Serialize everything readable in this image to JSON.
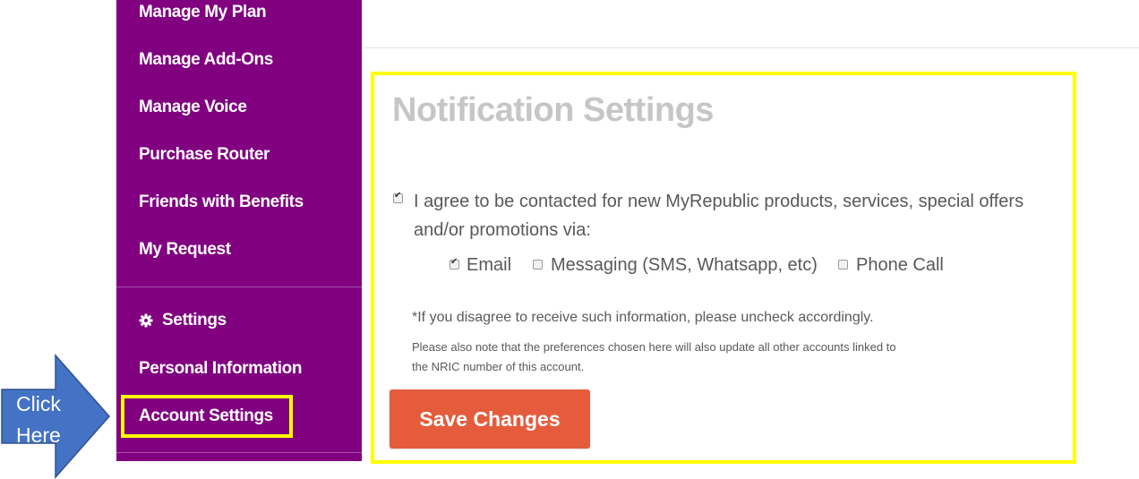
{
  "sidebar": {
    "items": [
      {
        "label": "Manage My Plan"
      },
      {
        "label": "Manage Add-Ons"
      },
      {
        "label": "Manage Voice"
      },
      {
        "label": "Purchase Router"
      },
      {
        "label": "Friends with Benefits"
      },
      {
        "label": "My Request"
      }
    ],
    "settings_heading": "Settings",
    "settings_items": [
      {
        "label": "Personal Information"
      },
      {
        "label": "Account Settings"
      }
    ],
    "bg_color": "#800080"
  },
  "callout": {
    "text_line1": "Click",
    "text_line2": "Here",
    "color": "#4472c4"
  },
  "notification": {
    "title": "Notification Settings",
    "agree_text": "I agree to be contacted for new MyRepublic products, services, special offers and/or promotions via:",
    "agree_checked": true,
    "options": [
      {
        "label": "Email",
        "checked": true
      },
      {
        "label": "Messaging (SMS, Whatsapp, etc)",
        "checked": false
      },
      {
        "label": "Phone Call",
        "checked": false
      }
    ],
    "note_primary": "*If you disagree to receive such information, please uncheck accordingly.",
    "note_secondary": "Please also note that the preferences chosen here will also update all other accounts linked to the NRIC number of this account.",
    "save_label": "Save Changes",
    "save_color": "#e55c3c"
  },
  "highlight_color": "#ffff00"
}
